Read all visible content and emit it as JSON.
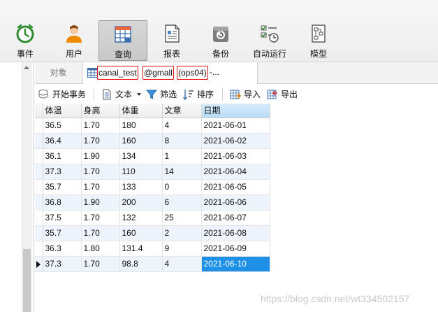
{
  "toolbar": {
    "items": [
      {
        "label": "事件",
        "icon": "event-clock-icon"
      },
      {
        "label": "用户",
        "icon": "user-icon"
      },
      {
        "label": "查询",
        "icon": "query-table-icon",
        "active": true
      },
      {
        "label": "报表",
        "icon": "report-icon"
      },
      {
        "label": "备份",
        "icon": "backup-icon"
      },
      {
        "label": "自动运行",
        "icon": "autorun-icon"
      },
      {
        "label": "模型",
        "icon": "model-icon"
      }
    ]
  },
  "tabs": {
    "objects_label": "对象",
    "query_tab": {
      "table_name": "canal_test",
      "connection": "@gmall",
      "server": "(ops04)",
      "suffix": "-..."
    }
  },
  "subtoolbar": {
    "begin_transaction": "开始事务",
    "text": "文本",
    "filter": "筛选",
    "sort": "排序",
    "import": "导入",
    "export": "导出"
  },
  "grid": {
    "columns": [
      "体温",
      "身高",
      "体重",
      "文章",
      "日期"
    ],
    "rows": [
      [
        "36.5",
        "1.70",
        "180",
        "4",
        "2021-06-01"
      ],
      [
        "36.4",
        "1.70",
        "160",
        "8",
        "2021-06-02"
      ],
      [
        "36.1",
        "1.90",
        "134",
        "1",
        "2021-06-03"
      ],
      [
        "37.3",
        "1.70",
        "110",
        "14",
        "2021-06-04"
      ],
      [
        "35.7",
        "1.70",
        "133",
        "0",
        "2021-06-05"
      ],
      [
        "36.8",
        "1.90",
        "200",
        "6",
        "2021-06-06"
      ],
      [
        "37.5",
        "1.70",
        "132",
        "25",
        "2021-06-07"
      ],
      [
        "35.7",
        "1.70",
        "160",
        "2",
        "2021-06-08"
      ],
      [
        "36.3",
        "1.80",
        "131.4",
        "9",
        "2021-06-09"
      ],
      [
        "37.3",
        "1.70",
        "98.8",
        "4",
        "2021-06-10"
      ]
    ],
    "selected_row": 9,
    "selected_column": 4
  },
  "watermark": "https://blog.csdn.net/wt334502157",
  "colors": {
    "selection": "#1e90e8",
    "highlight_box": "#e01010",
    "alt_row": "#eef4fb"
  }
}
